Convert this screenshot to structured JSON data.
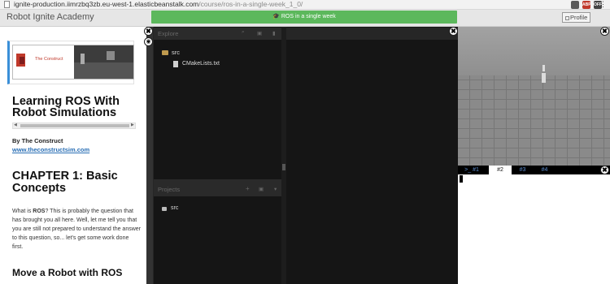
{
  "browser": {
    "url_host": "ignite-production.iimrzbq3zb.eu-west-1.elasticbeanstalk.com",
    "url_path": "/course/ros-in-a-single-week_1_0/",
    "extensions": [
      {
        "label": "",
        "color": "#5a5a5a"
      },
      {
        "label": "ABP",
        "color": "#c0392b"
      },
      {
        "label": "OFF",
        "color": "#444444"
      }
    ],
    "menu": "⋮"
  },
  "header": {
    "brand": "Robot Ignite Academy",
    "course_title": "ROS in a single week",
    "profile": "Profile"
  },
  "notebook": {
    "logo_text": "The Construct",
    "logo_sub": "",
    "title": "Learning ROS With Robot Simulations",
    "by": "By The Construct",
    "site": "www.theconstructsim.com",
    "chapter": "CHAPTER 1: Basic Concepts",
    "para_prefix": "What is ",
    "para_bold": "ROS",
    "para_rest": "? This is probably the question that has brought you all here. Well, let me tell you that you are still not prepared to understand the answer to this question, so... let's get some work done first.",
    "section": "Move a Robot with ROS"
  },
  "ide": {
    "explore_label": "Explore",
    "tree": [
      {
        "name": "src",
        "type": "folder"
      },
      {
        "name": "CMakeLists.txt",
        "type": "file"
      }
    ],
    "projects_label": "Projects",
    "projects": [
      {
        "name": "src"
      }
    ]
  },
  "shell": {
    "tabs": [
      {
        "label": ">_ #1",
        "active": false
      },
      {
        "label": "#2",
        "active": true
      },
      {
        "label": "#3",
        "active": false
      },
      {
        "label": "#4",
        "active": false
      }
    ]
  },
  "icons": {
    "close": "✖",
    "eye": "👁",
    "search": "🔍",
    "camera": "▣",
    "lock": "🔒",
    "plus": "+",
    "caret": "▾"
  }
}
